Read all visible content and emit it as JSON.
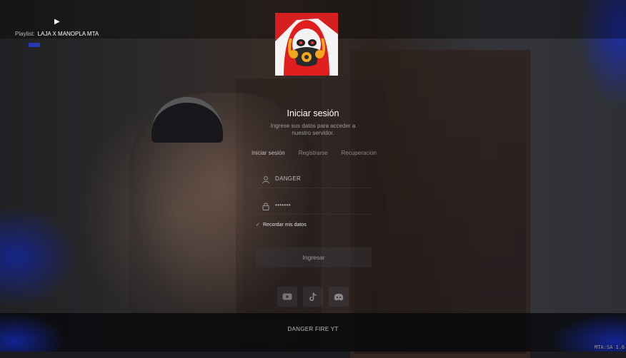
{
  "player": {
    "play_symbol": "▶",
    "playlist_label": "Playlist:",
    "playlist_value": "LAJA X  MANOPLA MTA",
    "progress_fraction": 0.5,
    "accent_color": "#2a3ed8"
  },
  "login": {
    "logo_icon": "gasmask-skull-icon",
    "title": "Iniciar sesión",
    "subtitle": "Ingrese sus datos para acceder a nuestro servidor.",
    "tabs": [
      "Iniciar sesión",
      "Registrarse",
      "Recuperacion"
    ],
    "active_tab": 0,
    "username_value": "DANGER",
    "password_value": "•••••••",
    "remember_label": "Recordar mis datos",
    "remember_checked": true,
    "submit_label": "Ingresar",
    "socials": [
      "youtube-icon",
      "tiktok-icon",
      "discord-icon"
    ]
  },
  "footer": {
    "brand": "DANGER FIRE YT",
    "version": "MTA:SA 1.6"
  }
}
